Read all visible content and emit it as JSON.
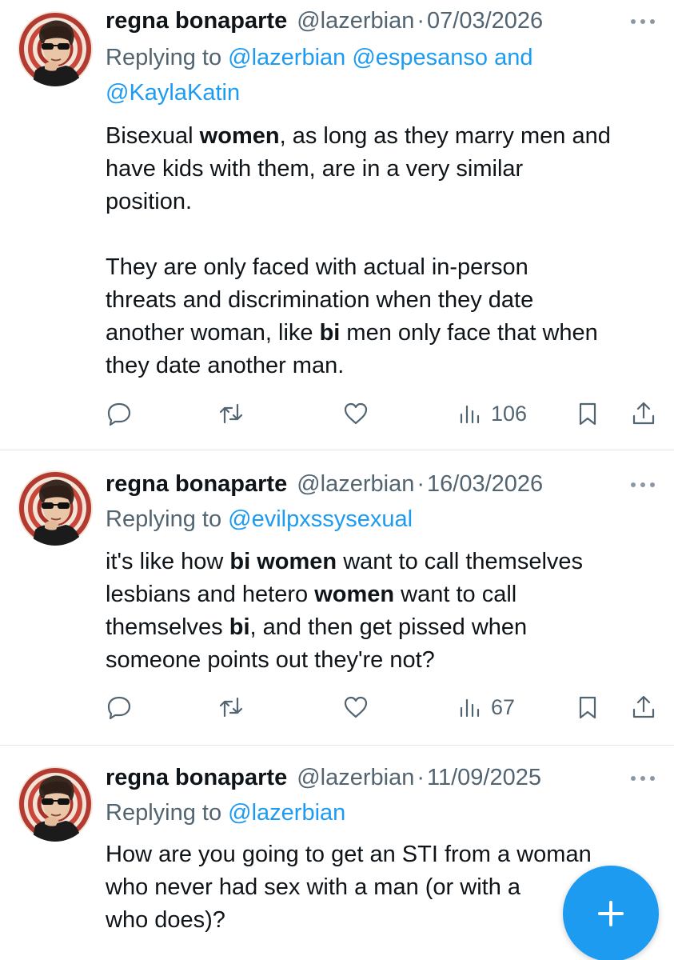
{
  "tweets": [
    {
      "name": "regna bonaparte",
      "handle": "@lazerbian",
      "separator": "·",
      "date": "07/03/2026",
      "replying_label": "Replying to",
      "replying_mentions": [
        "@lazerbian",
        "@espesanso"
      ],
      "replying_and": "and",
      "replying_last": "@KaylaKatin",
      "body": [
        [
          "Bisexual ",
          "women",
          ", as long as they marry men and"
        ],
        [
          "have kids with them, are in a very similar"
        ],
        [
          "position."
        ],
        [],
        [
          "They are only faced with actual in-person"
        ],
        [
          "threats and discrimination when they date"
        ],
        [
          "another woman, like ",
          "bi",
          " men only face that when"
        ],
        [
          "they date another man."
        ]
      ],
      "views": "106"
    },
    {
      "name": "regna bonaparte",
      "handle": "@lazerbian",
      "separator": "·",
      "date": "16/03/2026",
      "replying_label": "Replying to",
      "replying_last": "@evilpxssysexual",
      "body": [
        [
          "it's like how ",
          "bi women",
          " want to call themselves"
        ],
        [
          "lesbians and hetero ",
          "women",
          " want to call"
        ],
        [
          "themselves ",
          "bi",
          ", and then get pissed when"
        ],
        [
          "someone points out they're not?"
        ]
      ],
      "views": "67"
    },
    {
      "name": "regna bonaparte",
      "handle": "@lazerbian",
      "separator": "·",
      "date": "11/09/2025",
      "replying_label": "Replying to",
      "replying_last": "@lazerbian",
      "body": [
        [
          "How are you going to get an STI from a woman"
        ],
        [
          "who never had sex with a man (or with a"
        ],
        [
          "who does)?"
        ]
      ]
    }
  ],
  "icons": {
    "reply": "reply-icon",
    "retweet": "retweet-icon",
    "like": "like-icon",
    "views": "views-icon",
    "bookmark": "bookmark-icon",
    "share": "share-icon",
    "compose": "plus-icon"
  },
  "colors": {
    "link": "#1d9bf0",
    "muted": "#536471",
    "text": "#0f1419",
    "fab": "#1d9bf0"
  }
}
